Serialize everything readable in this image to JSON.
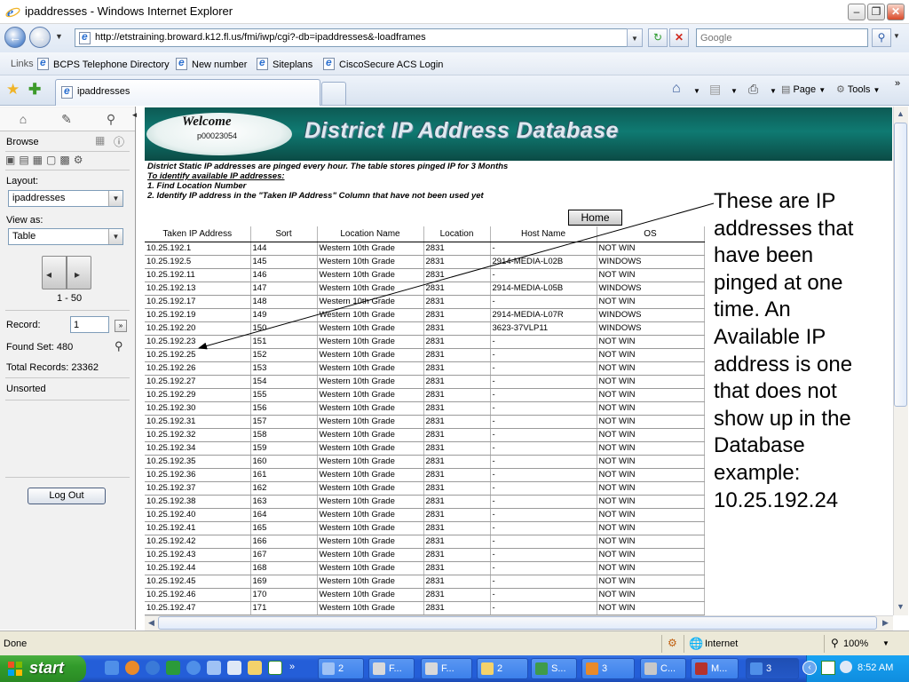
{
  "window": {
    "title": "ipaddresses - Windows Internet Explorer"
  },
  "address_bar": {
    "url": "http://etstraining.broward.k12.fl.us/fmi/iwp/cgi?-db=ipaddresses&-loadframes",
    "search_placeholder": "Google"
  },
  "links_bar": {
    "label": "Links",
    "items": [
      "BCPS Telephone Directory",
      "New number",
      "Siteplans",
      "CiscoSecure ACS Login"
    ]
  },
  "tabs": [
    {
      "label": "ipaddresses"
    }
  ],
  "command_bar": {
    "page_label": "Page",
    "tools_label": "Tools"
  },
  "sidebar": {
    "mode_label": "Browse",
    "layout_label": "Layout:",
    "layout_value": "ipaddresses",
    "view_label": "View as:",
    "view_value": "Table",
    "page_range": "1 - 50",
    "record_label": "Record:",
    "record_value": "1",
    "found_set": "Found Set: 480",
    "total_records": "Total Records: 23362",
    "sort_state": "Unsorted",
    "logout_label": "Log Out"
  },
  "content": {
    "welcome": "Welcome",
    "user_id": "p00023054",
    "banner_title": "District IP Address Database",
    "note_line1": "District Static IP addresses are pinged every hour. The table stores pinged IP for 3 Months",
    "note_line2": "To identify available IP addresses:",
    "note_line3": "1. Find Location Number",
    "note_line4": "2. Identify IP address in the \"Taken IP Address\" Column that have not been used yet",
    "home_button": "Home"
  },
  "table": {
    "columns": [
      "Taken IP Address",
      "Sort",
      "Location Name",
      "Location",
      "Host Name",
      "OS"
    ],
    "rows": [
      [
        "10.25.192.1",
        "144",
        "Western 10th Grade",
        "2831",
        "-",
        "NOT WIN"
      ],
      [
        "10.25.192.5",
        "145",
        "Western 10th Grade",
        "2831",
        "2914-MEDIA-L02B",
        "WINDOWS"
      ],
      [
        "10.25.192.11",
        "146",
        "Western 10th Grade",
        "2831",
        "-",
        "NOT WIN"
      ],
      [
        "10.25.192.13",
        "147",
        "Western 10th Grade",
        "2831",
        "2914-MEDIA-L05B",
        "WINDOWS"
      ],
      [
        "10.25.192.17",
        "148",
        "Western 10th Grade",
        "2831",
        "-",
        "NOT WIN"
      ],
      [
        "10.25.192.19",
        "149",
        "Western 10th Grade",
        "2831",
        "2914-MEDIA-L07R",
        "WINDOWS"
      ],
      [
        "10.25.192.20",
        "150",
        "Western 10th Grade",
        "2831",
        "3623-37VLP11",
        "WINDOWS"
      ],
      [
        "10.25.192.23",
        "151",
        "Western 10th Grade",
        "2831",
        "-",
        "NOT WIN"
      ],
      [
        "10.25.192.25",
        "152",
        "Western 10th Grade",
        "2831",
        "-",
        "NOT WIN"
      ],
      [
        "10.25.192.26",
        "153",
        "Western 10th Grade",
        "2831",
        "-",
        "NOT WIN"
      ],
      [
        "10.25.192.27",
        "154",
        "Western 10th Grade",
        "2831",
        "-",
        "NOT WIN"
      ],
      [
        "10.25.192.29",
        "155",
        "Western 10th Grade",
        "2831",
        "-",
        "NOT WIN"
      ],
      [
        "10.25.192.30",
        "156",
        "Western 10th Grade",
        "2831",
        "-",
        "NOT WIN"
      ],
      [
        "10.25.192.31",
        "157",
        "Western 10th Grade",
        "2831",
        "-",
        "NOT WIN"
      ],
      [
        "10.25.192.32",
        "158",
        "Western 10th Grade",
        "2831",
        "-",
        "NOT WIN"
      ],
      [
        "10.25.192.34",
        "159",
        "Western 10th Grade",
        "2831",
        "-",
        "NOT WIN"
      ],
      [
        "10.25.192.35",
        "160",
        "Western 10th Grade",
        "2831",
        "-",
        "NOT WIN"
      ],
      [
        "10.25.192.36",
        "161",
        "Western 10th Grade",
        "2831",
        "-",
        "NOT WIN"
      ],
      [
        "10.25.192.37",
        "162",
        "Western 10th Grade",
        "2831",
        "-",
        "NOT WIN"
      ],
      [
        "10.25.192.38",
        "163",
        "Western 10th Grade",
        "2831",
        "-",
        "NOT WIN"
      ],
      [
        "10.25.192.40",
        "164",
        "Western 10th Grade",
        "2831",
        "-",
        "NOT WIN"
      ],
      [
        "10.25.192.41",
        "165",
        "Western 10th Grade",
        "2831",
        "-",
        "NOT WIN"
      ],
      [
        "10.25.192.42",
        "166",
        "Western 10th Grade",
        "2831",
        "-",
        "NOT WIN"
      ],
      [
        "10.25.192.43",
        "167",
        "Western 10th Grade",
        "2831",
        "-",
        "NOT WIN"
      ],
      [
        "10.25.192.44",
        "168",
        "Western 10th Grade",
        "2831",
        "-",
        "NOT WIN"
      ],
      [
        "10.25.192.45",
        "169",
        "Western 10th Grade",
        "2831",
        "-",
        "NOT WIN"
      ],
      [
        "10.25.192.46",
        "170",
        "Western 10th Grade",
        "2831",
        "-",
        "NOT WIN"
      ],
      [
        "10.25.192.47",
        "171",
        "Western 10th Grade",
        "2831",
        "-",
        "NOT WIN"
      ]
    ]
  },
  "annotation": {
    "text": "These are IP addresses that have been pinged at one time.  An Available IP address is one that does not show up in the Database example: 10.25.192.24"
  },
  "status_bar": {
    "status": "Done",
    "zone": "Internet",
    "zoom": "100%"
  },
  "taskbar": {
    "start_label": "start",
    "buttons": [
      {
        "label": "2",
        "icon": "windows-group-icon",
        "color": "#9fc2f5"
      },
      {
        "label": "F...",
        "icon": "filemaker-icon",
        "color": "#d9d9d9"
      },
      {
        "label": "F...",
        "icon": "filemaker-icon",
        "color": "#d9d9d9"
      },
      {
        "label": "2",
        "icon": "folder-icon",
        "color": "#f4d26b"
      },
      {
        "label": "S...",
        "icon": "excel-icon",
        "color": "#3f9b4a"
      },
      {
        "label": "3",
        "icon": "firefox-icon",
        "color": "#e98a2a"
      },
      {
        "label": "C...",
        "icon": "calculator-icon",
        "color": "#c8c8c8"
      },
      {
        "label": "M...",
        "icon": "access-icon",
        "color": "#b5322c"
      },
      {
        "label": "3",
        "icon": "ie-icon",
        "color": "#4f8fe8"
      }
    ],
    "clock": "8:52 AM"
  },
  "colors": {
    "banner": "#0f7a72",
    "taskbar": "#245ed8",
    "start": "#329b2b"
  }
}
